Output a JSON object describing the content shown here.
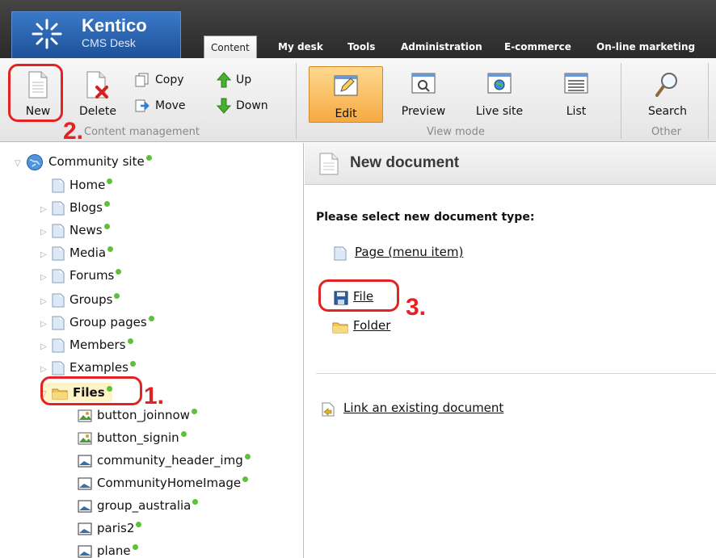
{
  "logo": {
    "brand": "Kentico",
    "product": "CMS Desk"
  },
  "tabs": [
    "Content",
    "My desk",
    "Tools",
    "Administration",
    "E-commerce",
    "On-line marketing"
  ],
  "ribbon": {
    "content_management": {
      "new": "New",
      "delete": "Delete",
      "copy": "Copy",
      "move": "Move",
      "up": "Up",
      "down": "Down",
      "group_label": "Content management"
    },
    "view_mode": {
      "edit": "Edit",
      "preview": "Preview",
      "live_site": "Live site",
      "list": "List",
      "group_label": "View mode"
    },
    "other": {
      "search": "Search",
      "group_label": "Other"
    }
  },
  "tree": {
    "root": "Community site",
    "items": [
      "Home",
      "Blogs",
      "News",
      "Media",
      "Forums",
      "Groups",
      "Group pages",
      "Members",
      "Examples",
      "Files"
    ],
    "files": [
      "button_joinnow",
      "button_signin",
      "community_header_img",
      "CommunityHomeImage",
      "group_australia",
      "paris2",
      "plane"
    ]
  },
  "panel": {
    "title": "New document",
    "prompt": "Please select new document type:",
    "types": [
      "Page (menu item)",
      "File",
      "Folder"
    ],
    "link_existing": "Link an existing document"
  },
  "annotations": [
    "1.",
    "2.",
    "3."
  ],
  "colors": {
    "annotation": "#e32222",
    "status_dot": "#5fbf3a",
    "accent": "#f5a940"
  }
}
